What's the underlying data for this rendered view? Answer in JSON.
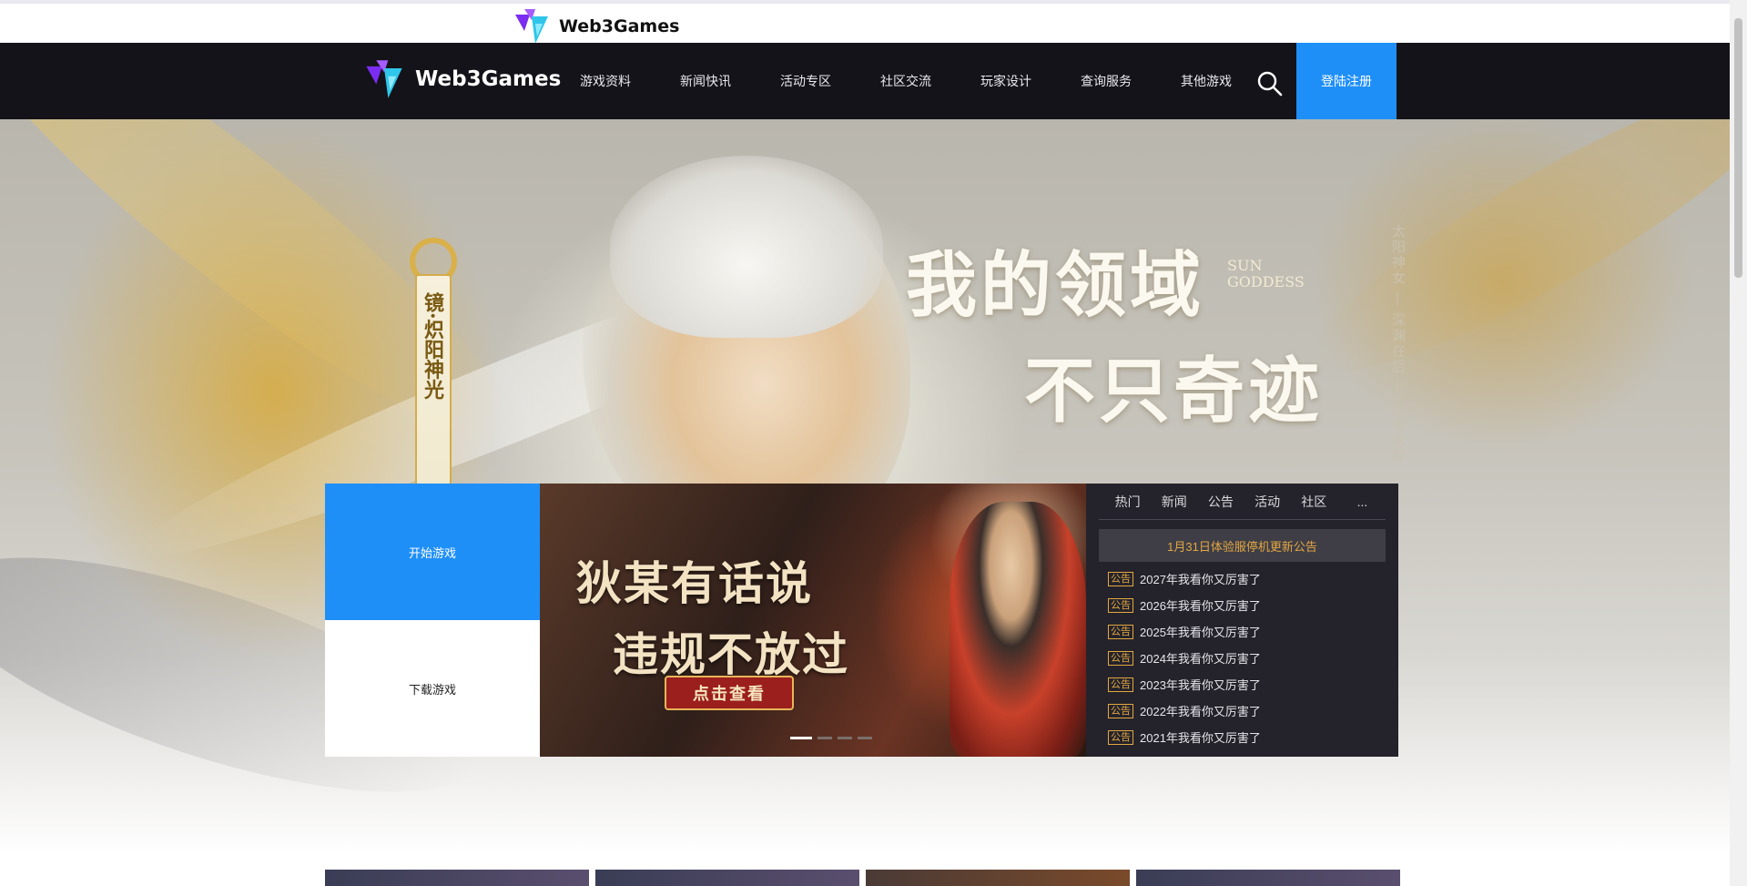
{
  "brand": {
    "name": "Web3Games"
  },
  "nav": {
    "items": [
      "游戏资料",
      "新闻快讯",
      "活动专区",
      "社区交流",
      "玩家设计",
      "查询服务",
      "其他游戏"
    ],
    "login": "登陆注册"
  },
  "hero": {
    "slogan_line1": "我的领域",
    "slogan_line2": "不只奇迹",
    "sun_goddess": "SUN GODDESS",
    "skin_title": "镜·炽阳神光",
    "side_text": "太阳神女 — 深渊在后 — 光明永存"
  },
  "panel": {
    "start_game": "开始游戏",
    "download_game": "下载游戏"
  },
  "carousel": {
    "line1": "狄某有话说",
    "line2": "违规不放过",
    "cta": "点击查看",
    "active_slide": 1,
    "slide_count": 4
  },
  "news": {
    "tabs": [
      "热门",
      "新闻",
      "公告",
      "活动",
      "社区",
      "..."
    ],
    "headline": "1月31日体验服停机更新公告",
    "badge": "公告",
    "items": [
      "2027年我看你又厉害了",
      "2026年我看你又厉害了",
      "2025年我看你又厉害了",
      "2024年我看你又厉害了",
      "2023年我看你又厉害了",
      "2022年我看你又厉害了",
      "2021年我看你又厉害了"
    ]
  },
  "colors": {
    "accent": "#1f8ff8",
    "nav_bg": "#141319",
    "news_bg": "#24232b",
    "badge": "#e3a742"
  },
  "icons": {
    "search": "search-icon",
    "logo": "web3games-logo-icon"
  }
}
